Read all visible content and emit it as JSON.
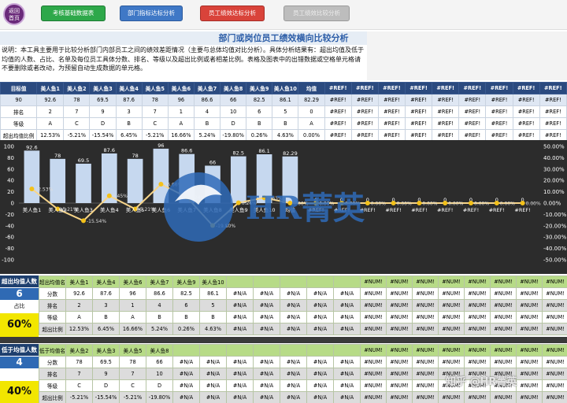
{
  "toolbar": {
    "home_l1": "返回",
    "home_l2": "首页",
    "btn_kpi_table": "考核基础数据表",
    "btn_dept_rate": "部门指标达标分析",
    "btn_staff_rate": "员工绩效达标分析",
    "btn_staff_compare": "员工绩效比较分析"
  },
  "title": "部门或岗位员工绩效横向比较分析",
  "note": "说明：本工具主要用于比较分析部门内部员工之间的绩效差距情况（主要与总体均值对比分析）。具体分析结果有：超出均值及低于均值的人数、占比、名单及每位员工具体分数、排名、等级以及超出比例或者相差比例。表格及图表中的出错数据或空格单元格请不要删除或者改动，为预留自动生成数据的单元格。",
  "top_table": {
    "headers": [
      "目标值",
      "美人鱼1",
      "美人鱼2",
      "美人鱼3",
      "美人鱼4",
      "美人鱼5",
      "美人鱼6",
      "美人鱼7",
      "美人鱼8",
      "美人鱼9",
      "美人鱼10",
      "均值",
      "#REF!",
      "#REF!",
      "#REF!",
      "#REF!",
      "#REF!",
      "#REF!",
      "#REF!",
      "#REF!",
      "#REF!"
    ],
    "score_row": [
      "90",
      "92.6",
      "78",
      "69.5",
      "87.6",
      "78",
      "96",
      "86.6",
      "66",
      "82.5",
      "86.1",
      "82.29",
      "#REF!",
      "#REF!",
      "#REF!",
      "#REF!",
      "#REF!",
      "#REF!",
      "#REF!",
      "#REF!",
      "#REF!"
    ],
    "rank_row": [
      "排名",
      "2",
      "7",
      "9",
      "3",
      "7",
      "1",
      "4",
      "10",
      "6",
      "5",
      "0",
      "#REF!",
      "#REF!",
      "#REF!",
      "#REF!",
      "#REF!",
      "#REF!",
      "#REF!",
      "#REF!",
      "#REF!"
    ],
    "grade_row": [
      "等级",
      "A",
      "C",
      "D",
      "B",
      "C",
      "A",
      "B",
      "D",
      "B",
      "B",
      "A",
      "#REF!",
      "#REF!",
      "#REF!",
      "#REF!",
      "#REF!",
      "#REF!",
      "#REF!",
      "#REF!",
      "#REF!"
    ],
    "ratio_row": [
      "超出均值比例",
      "12.53%",
      "-5.21%",
      "-15.54%",
      "6.45%",
      "-5.21%",
      "16.66%",
      "5.24%",
      "-19.80%",
      "0.26%",
      "4.63%",
      "0.00%",
      "#REF!",
      "#REF!",
      "#REF!",
      "#REF!",
      "#REF!",
      "#REF!",
      "#REF!",
      "#REF!",
      "#REF!"
    ]
  },
  "chart_data": {
    "type": "bar",
    "categories": [
      "美人鱼1",
      "美人鱼2",
      "美人鱼3",
      "美人鱼4",
      "美人鱼5",
      "美人鱼6",
      "美人鱼7",
      "美人鱼8",
      "美人鱼9",
      "美人鱼10",
      "均值",
      "#REF!",
      "#REF!",
      "#REF!",
      "#REF!",
      "#REF!",
      "#REF!",
      "#REF!",
      "#REF!",
      "#REF!"
    ],
    "series": [
      {
        "values": [
          92.6,
          78,
          69.5,
          87.6,
          78,
          96,
          86.6,
          66,
          82.5,
          86.1,
          82.29,
          0,
          0,
          0,
          0,
          0,
          0,
          0,
          0,
          0
        ]
      },
      {
        "values": [
          12.53,
          -5.21,
          -15.54,
          6.45,
          -5.21,
          16.66,
          5.24,
          -19.8,
          0.26,
          4.63,
          0,
          0,
          0,
          0,
          0,
          0,
          0,
          0,
          0,
          0
        ]
      }
    ],
    "bar_labels": [
      "92.6",
      "78",
      "69.5",
      "87.6",
      "78",
      "96",
      "86.6",
      "66",
      "82.5",
      "86.1",
      "82.29",
      "0",
      "0",
      "0",
      "0",
      "0",
      "0",
      "0",
      "0",
      "0"
    ],
    "line_labels": [
      "12.53%",
      "-5.21%",
      "-15.54%",
      "6.45%",
      "-5.21%",
      "16.66%",
      "5.24%",
      "-19.80%",
      "0.26%",
      "4.63%",
      "0.00%",
      "0.00%",
      "0.00%",
      "0.00%",
      "0.00%",
      "0.00%",
      "0.00%",
      "0.00%",
      "0.00%",
      "0.00%"
    ],
    "left_ticks": [
      "100",
      "80",
      "60",
      "40",
      "20",
      "0",
      "-20",
      "-40",
      "-60",
      "-80",
      "-100"
    ],
    "right_ticks": [
      "50.00%",
      "40.00%",
      "30.00%",
      "20.00%",
      "10.00%",
      "0.00%",
      "-10.00%",
      "-20.00%",
      "-30.00%",
      "-40.00%",
      "-50.00%"
    ],
    "ylim": [
      -100,
      100
    ],
    "y2lim": [
      -50,
      50
    ],
    "colors": {
      "bar": "#c6d8ef",
      "line": "#f7d58a",
      "marker": "#f3c11a",
      "bg": "#2c2c2c"
    },
    "grid": false
  },
  "above": {
    "label": "超出均值人数",
    "count": "6",
    "pct_small": "占比",
    "pct_big": "60%",
    "names_label": "超出均值名单",
    "names": [
      "美人鱼1",
      "美人鱼4",
      "美人鱼6",
      "美人鱼7",
      "美人鱼9",
      "美人鱼10",
      "",
      "",
      "",
      "",
      "",
      "#NUM!",
      "#NUM!",
      "#NUM!",
      "#NUM!",
      "#NUM!",
      "#NUM!",
      "#NUM!",
      "#NUM!"
    ],
    "rows": [
      {
        "label": "分数",
        "cells": [
          "92.6",
          "87.6",
          "96",
          "86.6",
          "82.5",
          "86.1",
          "#N/A",
          "#N/A",
          "#N/A",
          "#N/A",
          "#N/A",
          "#NUM!",
          "#NUM!",
          "#NUM!",
          "#NUM!",
          "#NUM!",
          "#NUM!",
          "#NUM!",
          "#NUM!"
        ]
      },
      {
        "label": "排名",
        "cells": [
          "2",
          "3",
          "1",
          "4",
          "6",
          "5",
          "#N/A",
          "#N/A",
          "#N/A",
          "#N/A",
          "#N/A",
          "#NUM!",
          "#NUM!",
          "#NUM!",
          "#NUM!",
          "#NUM!",
          "#NUM!",
          "#NUM!",
          "#NUM!"
        ]
      },
      {
        "label": "等级",
        "cells": [
          "A",
          "B",
          "A",
          "B",
          "B",
          "B",
          "#N/A",
          "#N/A",
          "#N/A",
          "#N/A",
          "#N/A",
          "#NUM!",
          "#NUM!",
          "#NUM!",
          "#NUM!",
          "#NUM!",
          "#NUM!",
          "#NUM!",
          "#NUM!"
        ]
      },
      {
        "label": "超出比例",
        "cells": [
          "12.53%",
          "6.45%",
          "16.66%",
          "5.24%",
          "0.26%",
          "4.63%",
          "#N/A",
          "#N/A",
          "#N/A",
          "#N/A",
          "#N/A",
          "#NUM!",
          "#NUM!",
          "#NUM!",
          "#NUM!",
          "#NUM!",
          "#NUM!",
          "#NUM!",
          "#NUM!"
        ]
      }
    ]
  },
  "below": {
    "label": "低于均值人数",
    "count": "4",
    "pct_big": "40%",
    "names_label": "低于均值名单",
    "names": [
      "美人鱼2",
      "美人鱼3",
      "美人鱼5",
      "美人鱼8",
      "",
      "",
      "",
      "",
      "",
      "",
      "",
      "#NUM!",
      "#NUM!",
      "#NUM!",
      "#NUM!",
      "#NUM!",
      "#NUM!",
      "#NUM!",
      "#NUM!"
    ],
    "rows": [
      {
        "label": "分数",
        "cells": [
          "78",
          "69.5",
          "78",
          "66",
          "#N/A",
          "#N/A",
          "#N/A",
          "#N/A",
          "#N/A",
          "#N/A",
          "#N/A",
          "#NUM!",
          "#NUM!",
          "#NUM!",
          "#NUM!",
          "#NUM!",
          "#NUM!",
          "#NUM!",
          "#NUM!"
        ]
      },
      {
        "label": "排名",
        "cells": [
          "7",
          "9",
          "7",
          "10",
          "#N/A",
          "#N/A",
          "#N/A",
          "#N/A",
          "#N/A",
          "#N/A",
          "#N/A",
          "#NUM!",
          "#NUM!",
          "#NUM!",
          "#NUM!",
          "#NUM!",
          "#NUM!",
          "#NUM!",
          "#NUM!"
        ]
      },
      {
        "label": "等级",
        "cells": [
          "C",
          "D",
          "C",
          "D",
          "#N/A",
          "#N/A",
          "#N/A",
          "#N/A",
          "#N/A",
          "#N/A",
          "#N/A",
          "#NUM!",
          "#NUM!",
          "#NUM!",
          "#NUM!",
          "#NUM!",
          "#NUM!",
          "#NUM!",
          "#NUM!"
        ]
      },
      {
        "label": "超出比例",
        "cells": [
          "-5.21%",
          "-15.54%",
          "-5.21%",
          "-19.80%",
          "#N/A",
          "#N/A",
          "#N/A",
          "#N/A",
          "#N/A",
          "#N/A",
          "#N/A",
          "#NUM!",
          "#NUM!",
          "#NUM!",
          "#NUM!",
          "#NUM!",
          "#NUM!",
          "#NUM!",
          "#NUM!"
        ]
      }
    ]
  },
  "watermark": {
    "logo_text": "HR菁英",
    "corner_text": "知乎 @HR菁英"
  }
}
